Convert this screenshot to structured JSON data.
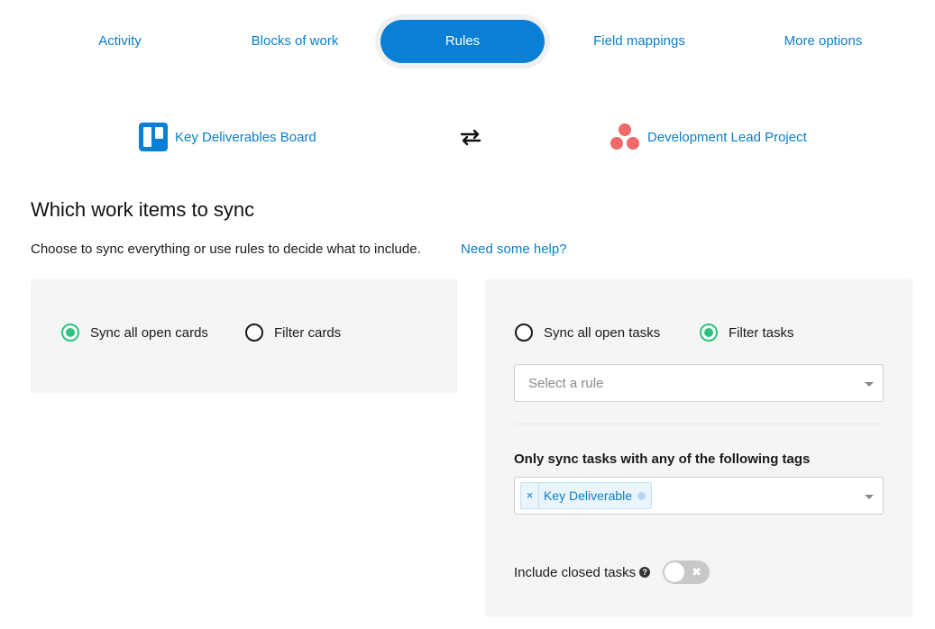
{
  "tabs": [
    {
      "label": "Activity",
      "active": false
    },
    {
      "label": "Blocks of work",
      "active": false
    },
    {
      "label": "Rules",
      "active": true
    },
    {
      "label": "Field mappings",
      "active": false
    },
    {
      "label": "More options",
      "active": false
    }
  ],
  "integration": {
    "left": {
      "name": "Key Deliverables Board",
      "icon": "trello-icon"
    },
    "swap_icon": "sync-arrows-icon",
    "right": {
      "name": "Development Lead Project",
      "icon": "asana-icon"
    }
  },
  "section": {
    "title": "Which work items to sync",
    "description": "Choose to sync everything or use rules to decide what to include.",
    "help_link": "Need some help?"
  },
  "left_panel": {
    "options": [
      {
        "label": "Sync all open cards",
        "checked": true
      },
      {
        "label": "Filter cards",
        "checked": false
      }
    ]
  },
  "right_panel": {
    "options": [
      {
        "label": "Sync all open tasks",
        "checked": false
      },
      {
        "label": "Filter tasks",
        "checked": true
      }
    ],
    "rule_select": {
      "placeholder": "Select a rule"
    },
    "tags_label": "Only sync tasks with any of the following tags",
    "tags": [
      {
        "label": "Key Deliverable",
        "remove": "×"
      }
    ],
    "include_closed": {
      "label": "Include closed tasks",
      "help": "?",
      "enabled": false,
      "toggle_off_glyph": "✖"
    }
  },
  "colors": {
    "accent": "#0a7fd6",
    "link": "#0a7fc7",
    "radio_checked": "#2ec27e",
    "panel_bg": "#f5f5f5",
    "asana": "#f06a6a"
  }
}
